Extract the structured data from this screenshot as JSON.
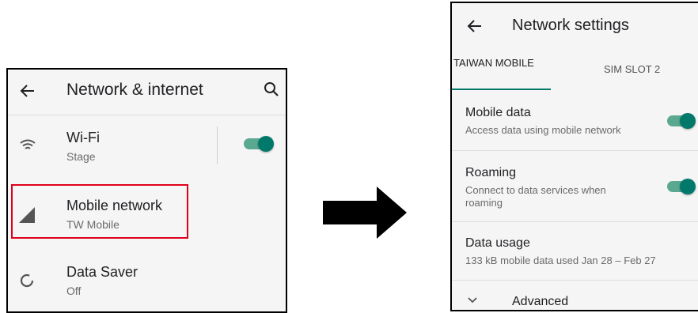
{
  "left_screen": {
    "title": "Network & internet",
    "items": [
      {
        "label": "Wi-Fi",
        "sub": "Stage",
        "icon": "wifi-icon",
        "toggle": true
      },
      {
        "label": "Mobile network",
        "sub": "TW Mobile",
        "icon": "signal-icon",
        "highlighted": true
      },
      {
        "label": "Data Saver",
        "sub": "Off",
        "icon": "data-saver-icon"
      }
    ]
  },
  "right_screen": {
    "title": "Network settings",
    "tabs": [
      {
        "label": "TAIWAN MOBILE",
        "selected": true
      },
      {
        "label": "SIM SLOT 2",
        "selected": false
      }
    ],
    "items": [
      {
        "label": "Mobile data",
        "sub": "Access data using mobile network",
        "toggle": true
      },
      {
        "label": "Roaming",
        "sub_line1": "Connect to data services when",
        "sub_line2": "roaming",
        "toggle": true
      },
      {
        "label": "Data usage",
        "sub": "133 kB mobile data used Jan 28 – Feb 27"
      },
      {
        "label": "Advanced",
        "icon": "chevron-down-icon"
      }
    ]
  },
  "colors": {
    "accent": "#00796b",
    "highlight": "#e0001b",
    "background": "#f5f5f5"
  }
}
